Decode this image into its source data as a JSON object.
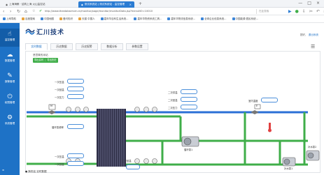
{
  "browser": {
    "tab_inactive": "上海海鲸 · 结构上海 火山监控站",
    "tab_active": "测试系统站 | 测试系统站 - 监控管理",
    "new_tab": "+",
    "url": "http://www.theatabserver.cn/monitor/page/monitor/monitorData.jsp?menuNO=10010",
    "url_badge": "f",
    "search_placeholder": "在此搜索",
    "window_controls": [
      "—",
      "□",
      "×"
    ],
    "bookmarks": [
      "上网导航",
      "百度搜索",
      "中国地图",
      "爱问知识",
      "天猫 中国人",
      "嘉年华百科生活系统...",
      "嘉年华物资系统工具...",
      "嘉年华物流信息系统...",
      "全球企业信息系统...",
      "中国能源·居民系统..."
    ]
  },
  "sidebar": {
    "items": [
      {
        "label": "监控管理",
        "icon": "hand-icon"
      },
      {
        "label": "数据管理",
        "icon": "cloud-icon"
      },
      {
        "label": "报警管理",
        "icon": "edit-icon"
      },
      {
        "label": "权限管理",
        "icon": "power-icon"
      },
      {
        "label": "系统管理",
        "icon": "gear-icon"
      }
    ],
    "bottom": "≡"
  },
  "header": {
    "brand": "汇川技术",
    "user": "您好，",
    "logout": "退出系统"
  },
  "tabs": [
    "实时数据",
    "历史数据",
    "历史报警",
    "数据分析",
    "参数设置"
  ],
  "panel": {
    "title": "恶意降的添站",
    "buttons": [
      "导出实时",
      "导出历史"
    ]
  },
  "diagram": {
    "labels": {
      "top_left_1": "一次压温",
      "top_left_2": "一次回温",
      "left_mid": "一次压力",
      "pump_freq": "循环泵频率",
      "bottom_left_1": "一次压温",
      "bottom_left_2": "一次回温",
      "right_1": "二次供温",
      "right_2": "二次回温",
      "right_3": "二次压力",
      "heat_label": "室内温度",
      "bottom_right": "二次回温",
      "pump_a": "循环泵1",
      "pump_b": "补水泵1",
      "pump_c": "补水泵2",
      "valve_m": "M",
      "valve_e": "E"
    }
  },
  "footer": {
    "text": "● 换热站 实时数据"
  },
  "colors": {
    "sidebar": "#1e72c6",
    "pipe_green": "#3fae49",
    "pipe_blue": "#2b6fd6",
    "field_border": "#4b8fda"
  }
}
